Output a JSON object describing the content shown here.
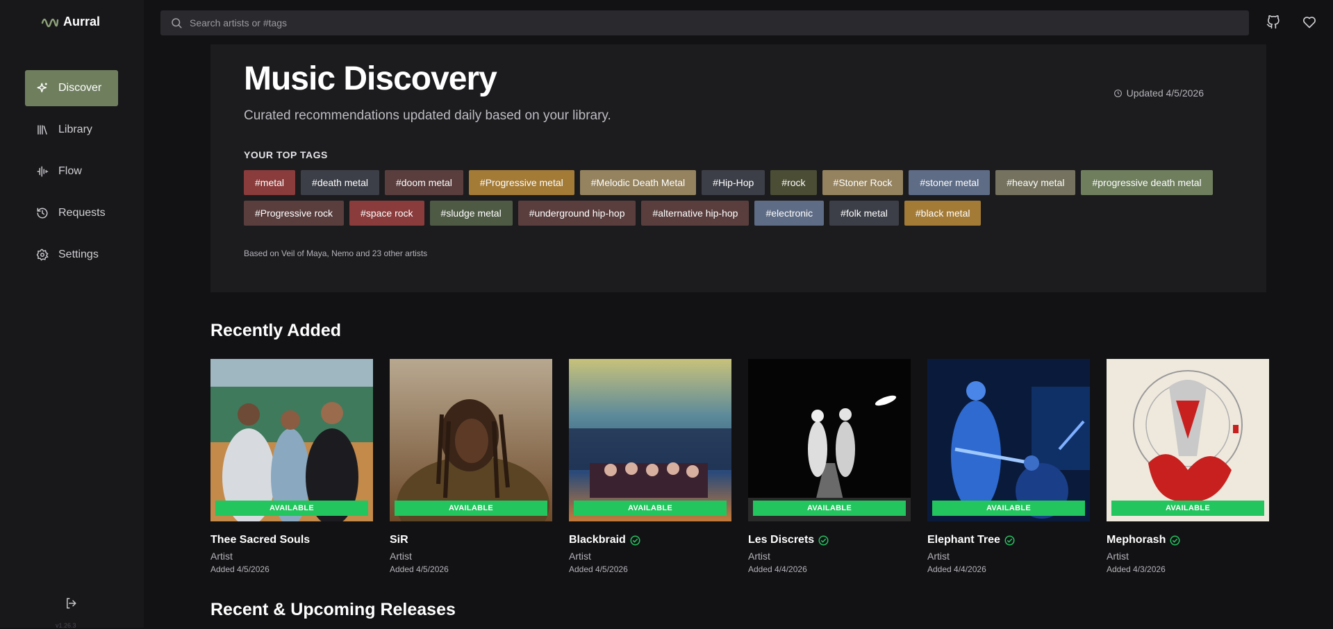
{
  "app": {
    "name": "Aurral",
    "version": "v1.26.3"
  },
  "sidebar": {
    "items": [
      {
        "label": "Discover",
        "icon": "sparkle-icon",
        "active": true
      },
      {
        "label": "Library",
        "icon": "library-icon",
        "active": false
      },
      {
        "label": "Flow",
        "icon": "waveform-icon",
        "active": false
      },
      {
        "label": "Requests",
        "icon": "history-icon",
        "active": false
      },
      {
        "label": "Settings",
        "icon": "gear-icon",
        "active": false
      }
    ]
  },
  "search": {
    "placeholder": "Search artists or #tags",
    "value": ""
  },
  "hero": {
    "title": "Music Discovery",
    "subtitle": "Curated recommendations updated daily based on your library.",
    "updated": "Updated 4/5/2026",
    "tags_label": "YOUR TOP TAGS",
    "tags": [
      {
        "label": "#metal",
        "color": "#8a3b3b"
      },
      {
        "label": "#death metal",
        "color": "#3d3f48"
      },
      {
        "label": "#doom metal",
        "color": "#5a3e3e"
      },
      {
        "label": "#Progressive metal",
        "color": "#a37b37"
      },
      {
        "label": "#Melodic Death Metal",
        "color": "#95835f"
      },
      {
        "label": "#Hip-Hop",
        "color": "#3d3f48"
      },
      {
        "label": "#rock",
        "color": "#4b4d34"
      },
      {
        "label": "#Stoner Rock",
        "color": "#95835f"
      },
      {
        "label": "#stoner metal",
        "color": "#5e6c86"
      },
      {
        "label": "#heavy metal",
        "color": "#75735f"
      },
      {
        "label": "#progressive death metal",
        "color": "#6f7f5e"
      },
      {
        "label": "#Progressive rock",
        "color": "#5a3e3e"
      },
      {
        "label": "#space rock",
        "color": "#8a3b3b"
      },
      {
        "label": "#sludge metal",
        "color": "#4f5a45"
      },
      {
        "label": "#underground hip-hop",
        "color": "#5a3e3e"
      },
      {
        "label": "#alternative hip-hop",
        "color": "#5a3e3e"
      },
      {
        "label": "#electronic",
        "color": "#5e6c86"
      },
      {
        "label": "#folk metal",
        "color": "#3d3f48"
      },
      {
        "label": "#black metal",
        "color": "#a37b37"
      }
    ],
    "based_on": "Based on Veil of Maya, Nemo and 23 other artists"
  },
  "recently_added": {
    "title": "Recently Added",
    "badge": "AVAILABLE",
    "items": [
      {
        "name": "Thee Sacred Souls",
        "type": "Artist",
        "added": "Added 4/5/2026",
        "verified": false
      },
      {
        "name": "SiR",
        "type": "Artist",
        "added": "Added 4/5/2026",
        "verified": false
      },
      {
        "name": "Blackbraid",
        "type": "Artist",
        "added": "Added 4/5/2026",
        "verified": true
      },
      {
        "name": "Les Discrets",
        "type": "Artist",
        "added": "Added 4/4/2026",
        "verified": true
      },
      {
        "name": "Elephant Tree",
        "type": "Artist",
        "added": "Added 4/4/2026",
        "verified": true
      },
      {
        "name": "Mephorash",
        "type": "Artist",
        "added": "Added 4/3/2026",
        "verified": true
      }
    ]
  },
  "releases": {
    "title": "Recent & Upcoming Releases"
  }
}
